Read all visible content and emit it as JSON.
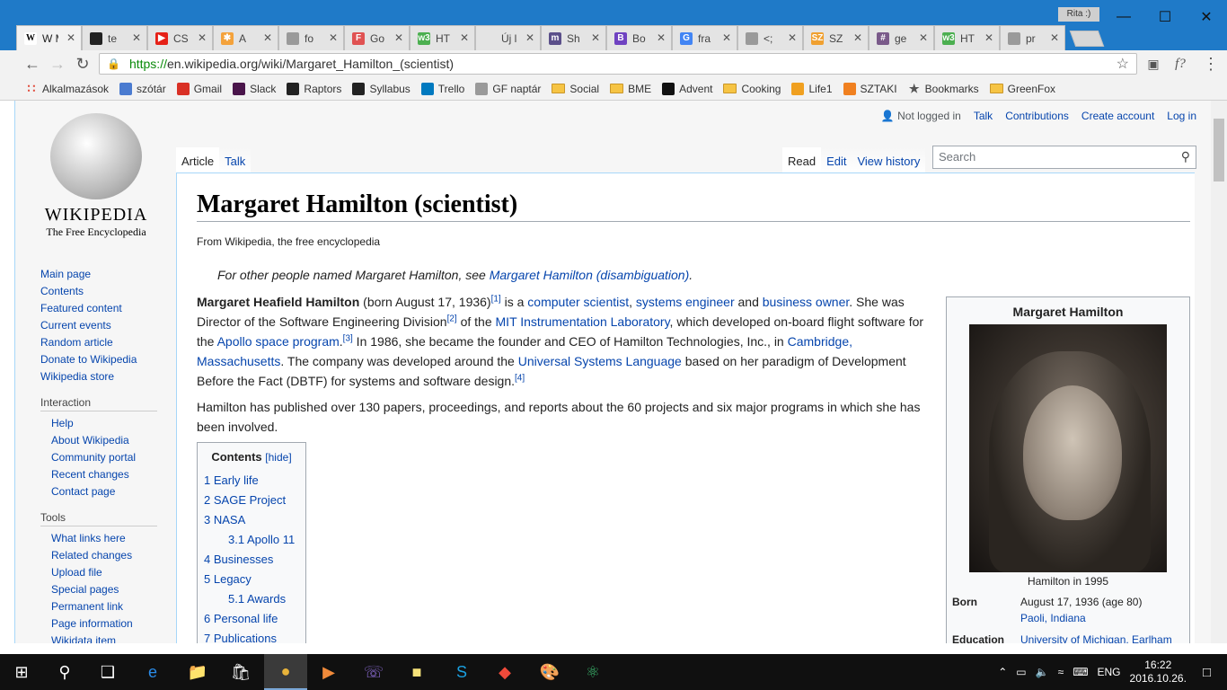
{
  "browser": {
    "user_badge": "Rita :)",
    "tabs": [
      {
        "title": "W M",
        "icon": "W",
        "icon_color": "#ffffff",
        "active": true
      },
      {
        "title": "te",
        "icon": "",
        "icon_color": "#222222"
      },
      {
        "title": "CS",
        "icon": "▶",
        "icon_color": "#e62117"
      },
      {
        "title": "A",
        "icon": "✱",
        "icon_color": "#f4a23b"
      },
      {
        "title": "fo",
        "icon": "",
        "icon_color": "#9a9a9a"
      },
      {
        "title": "Go",
        "icon": "F",
        "icon_color": "#e05252"
      },
      {
        "title": "HT",
        "icon": "w3",
        "icon_color": "#4caf50"
      },
      {
        "title": "Új lap",
        "icon": "",
        "icon_color": ""
      },
      {
        "title": "Sh",
        "icon": "m",
        "icon_color": "#5b4f8a"
      },
      {
        "title": "Bo",
        "icon": "B",
        "icon_color": "#6f42c1"
      },
      {
        "title": "fra",
        "icon": "G",
        "icon_color": "#4285f4"
      },
      {
        "title": "<;",
        "icon": "",
        "icon_color": "#9a9a9a"
      },
      {
        "title": "SZ",
        "icon": "SZ",
        "icon_color": "#f0a030"
      },
      {
        "title": "ge",
        "icon": "#",
        "icon_color": "#7a5a8a"
      },
      {
        "title": "HT",
        "icon": "w3",
        "icon_color": "#4caf50"
      },
      {
        "title": "pr",
        "icon": "",
        "icon_color": "#9a9a9a"
      }
    ],
    "url_scheme": "https://",
    "url_host": "en.wikipedia.org",
    "url_path": "/wiki/Margaret_Hamilton_(scientist)",
    "bookmarks": [
      {
        "label": "Alkalmazások",
        "kind": "apps",
        "color": "#e04a3a"
      },
      {
        "label": "szótár",
        "kind": "icon",
        "color": "#4a7bd0"
      },
      {
        "label": "Gmail",
        "kind": "icon",
        "color": "#d93025"
      },
      {
        "label": "Slack",
        "kind": "icon",
        "color": "#4a154b"
      },
      {
        "label": "Raptors",
        "kind": "icon",
        "color": "#222222"
      },
      {
        "label": "Syllabus",
        "kind": "icon",
        "color": "#222222"
      },
      {
        "label": "Trello",
        "kind": "icon",
        "color": "#0079bf"
      },
      {
        "label": "GF naptár",
        "kind": "icon",
        "color": "#9a9a9a"
      },
      {
        "label": "Social",
        "kind": "folder",
        "color": "#f6c444"
      },
      {
        "label": "BME",
        "kind": "folder",
        "color": "#f6c444"
      },
      {
        "label": "Advent",
        "kind": "icon",
        "color": "#111111"
      },
      {
        "label": "Cooking",
        "kind": "folder",
        "color": "#f6c444"
      },
      {
        "label": "Life1",
        "kind": "icon",
        "color": "#f0a020"
      },
      {
        "label": "SZTAKI",
        "kind": "icon",
        "color": "#f08020"
      },
      {
        "label": "Bookmarks",
        "kind": "star",
        "color": "#555555"
      },
      {
        "label": "GreenFox",
        "kind": "folder",
        "color": "#f6c444"
      }
    ]
  },
  "wiki": {
    "wordmark": "WIKIPEDIA",
    "tagline": "The Free Encyclopedia",
    "personal": {
      "not_logged": "Not logged in",
      "talk": "Talk",
      "contributions": "Contributions",
      "create": "Create account",
      "login": "Log in"
    },
    "tab_article": "Article",
    "tab_talk": "Talk",
    "tab_read": "Read",
    "tab_edit": "Edit",
    "tab_history": "View history",
    "search_placeholder": "Search",
    "nav_main": [
      "Main page",
      "Contents",
      "Featured content",
      "Current events",
      "Random article",
      "Donate to Wikipedia",
      "Wikipedia store"
    ],
    "interaction_heading": "Interaction",
    "nav_interaction": [
      "Help",
      "About Wikipedia",
      "Community portal",
      "Recent changes",
      "Contact page"
    ],
    "tools_heading": "Tools",
    "nav_tools": [
      "What links here",
      "Related changes",
      "Upload file",
      "Special pages",
      "Permanent link",
      "Page information",
      "Wikidata item"
    ],
    "title": "Margaret Hamilton (scientist)",
    "sitesub": "From Wikipedia, the free encyclopedia",
    "hatnote_prefix": "For other people named Margaret Hamilton, see ",
    "hatnote_link": "Margaret Hamilton (disambiguation)",
    "hatnote_suffix": ".",
    "p1": {
      "bold": "Margaret Heafield Hamilton",
      "t1": " (born August 17, 1936)",
      "r1": "[1]",
      "t2": " is a ",
      "l1": "computer scientist",
      "t3": ", ",
      "l2": "systems engineer",
      "t4": " and ",
      "l3": "business owner",
      "t5": ". She was Director of the Software Engineering Division",
      "r2": "[2]",
      "t6": " of the ",
      "l4": "MIT Instrumentation Laboratory",
      "t7": ", which developed on-board flight software for the ",
      "l5": "Apollo space program",
      "t8": ".",
      "r3": "[3]",
      "t9": " In 1986, she became the founder and CEO of Hamilton Technologies, Inc., in ",
      "l6": "Cambridge, Massachusetts",
      "t10": ". The company was developed around the ",
      "l7": "Universal Systems Language",
      "t11": " based on her paradigm of Development Before the Fact (DBTF) for systems and software design.",
      "r4": "[4]"
    },
    "p2": "Hamilton has published over 130 papers, proceedings, and reports about the 60 projects and six major programs in which she has been involved.",
    "toc": {
      "title": "Contents",
      "hide": "[hide]",
      "items": [
        {
          "num": "1",
          "label": "Early life",
          "level": 1
        },
        {
          "num": "2",
          "label": "SAGE Project",
          "level": 1
        },
        {
          "num": "3",
          "label": "NASA",
          "level": 1
        },
        {
          "num": "3.1",
          "label": "Apollo 11",
          "level": 2
        },
        {
          "num": "4",
          "label": "Businesses",
          "level": 1
        },
        {
          "num": "5",
          "label": "Legacy",
          "level": 1
        },
        {
          "num": "5.1",
          "label": "Awards",
          "level": 2
        },
        {
          "num": "6",
          "label": "Personal life",
          "level": 1
        },
        {
          "num": "7",
          "label": "Publications",
          "level": 1
        }
      ]
    },
    "infobox": {
      "name": "Margaret Hamilton",
      "caption": "Hamilton in 1995",
      "born_label": "Born",
      "born_value": "August 17, 1936 (age 80)",
      "born_place": "Paoli, Indiana",
      "education_label": "Education",
      "education_value": "University of Michigan, Earlham"
    }
  },
  "taskbar": {
    "lang": "ENG",
    "time": "16:22",
    "date": "2016.10.26."
  }
}
